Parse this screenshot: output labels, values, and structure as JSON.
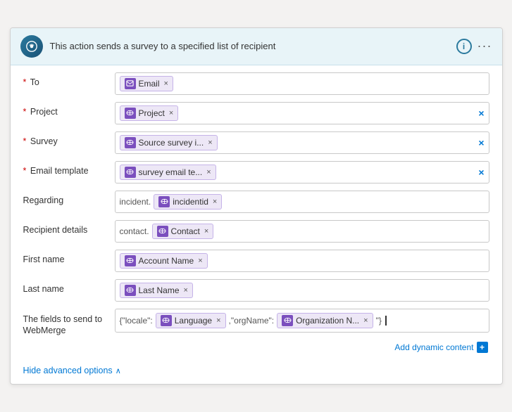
{
  "header": {
    "title": "This action sends a survey to a specified list of recipient",
    "info_label": "i",
    "more_label": "···"
  },
  "fields": [
    {
      "id": "to",
      "label": "To",
      "required": true,
      "tokens": [
        {
          "text": "Email",
          "has_icon": true
        }
      ],
      "has_clear": false,
      "prefix": null
    },
    {
      "id": "project",
      "label": "Project",
      "required": true,
      "tokens": [
        {
          "text": "Project",
          "has_icon": true
        }
      ],
      "has_clear": true,
      "prefix": null
    },
    {
      "id": "survey",
      "label": "Survey",
      "required": true,
      "tokens": [
        {
          "text": "Source survey i...",
          "has_icon": true
        }
      ],
      "has_clear": true,
      "prefix": null
    },
    {
      "id": "email-template",
      "label": "Email template",
      "required": true,
      "tokens": [
        {
          "text": "survey email te...",
          "has_icon": true
        }
      ],
      "has_clear": true,
      "prefix": null
    },
    {
      "id": "regarding",
      "label": "Regarding",
      "required": false,
      "tokens": [
        {
          "text": "incidentid",
          "has_icon": true
        }
      ],
      "has_clear": false,
      "prefix": "incident."
    },
    {
      "id": "recipient-details",
      "label": "Recipient details",
      "required": false,
      "tokens": [
        {
          "text": "Contact",
          "has_icon": true
        }
      ],
      "has_clear": false,
      "prefix": "contact."
    },
    {
      "id": "first-name",
      "label": "First name",
      "required": false,
      "tokens": [
        {
          "text": "Account Name",
          "has_icon": true
        }
      ],
      "has_clear": false,
      "prefix": null
    },
    {
      "id": "last-name",
      "label": "Last name",
      "required": false,
      "tokens": [
        {
          "text": "Last Name",
          "has_icon": true
        }
      ],
      "has_clear": false,
      "prefix": null
    },
    {
      "id": "webmerge",
      "label": "The fields to send to WebMerge",
      "required": false,
      "multiline": true,
      "tokens": [
        {
          "text": "Language",
          "has_icon": true
        },
        {
          "text": "Organization N...",
          "has_icon": true
        }
      ],
      "has_clear": false,
      "prefix_before_first": "{\"locale\":",
      "between": ",\"orgName\":",
      "suffix": "\"}"
    }
  ],
  "add_dynamic_label": "Add dynamic content",
  "hide_advanced_label": "Hide advanced options"
}
